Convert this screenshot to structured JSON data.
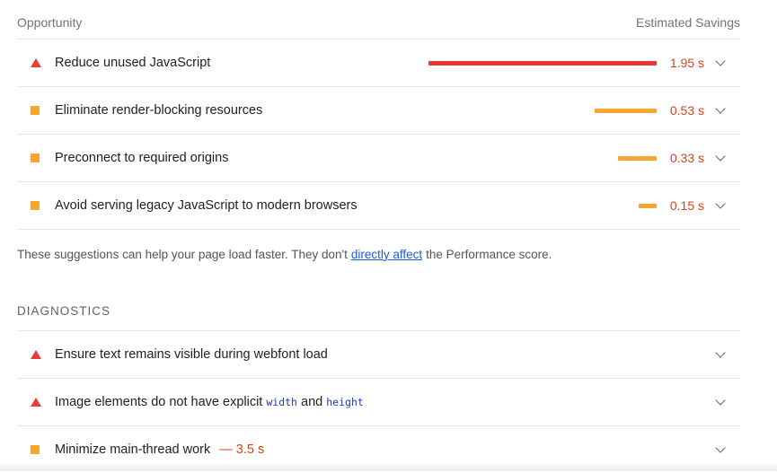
{
  "header": {
    "left": "Opportunity",
    "right": "Estimated Savings"
  },
  "opportunities": [
    {
      "icon": "red-triangle-icon",
      "title": "Reduce unused JavaScript",
      "savings": "1.95 s",
      "bar_fraction": 1.0,
      "bar_color": "#e8363a"
    },
    {
      "icon": "orange-square-icon",
      "title": "Eliminate render-blocking resources",
      "savings": "0.53 s",
      "bar_fraction": 0.27,
      "bar_color": "#f6a630"
    },
    {
      "icon": "orange-square-icon",
      "title": "Preconnect to required origins",
      "savings": "0.33 s",
      "bar_fraction": 0.17,
      "bar_color": "#f6a630"
    },
    {
      "icon": "orange-square-icon",
      "title": "Avoid serving legacy JavaScript to modern browsers",
      "savings": "0.15 s",
      "bar_fraction": 0.08,
      "bar_color": "#f6a630"
    }
  ],
  "note": {
    "before": "These suggestions can help your page load faster. They don't",
    "link": "directly affect",
    "after": "the Performance score."
  },
  "diagnostics": {
    "heading": "DIAGNOSTICS",
    "items": [
      {
        "icon": "red-triangle-icon",
        "title": "Ensure text remains visible during webfont load"
      },
      {
        "icon": "red-triangle-icon",
        "title_before": "Image elements do not have explicit",
        "code1": "width",
        "title_mid": "and",
        "code2": "height"
      },
      {
        "icon": "orange-square-icon",
        "title": "Minimize main-thread work",
        "value": "— 3.5 s"
      }
    ]
  }
}
